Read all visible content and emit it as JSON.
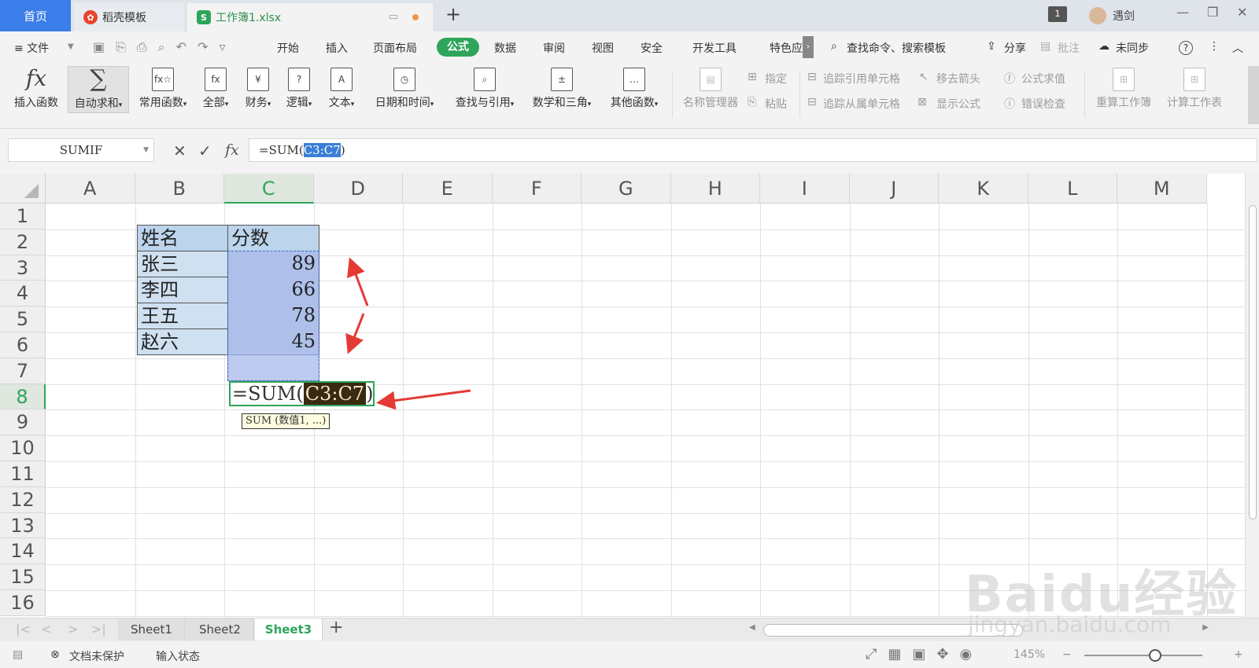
{
  "titlebar": {
    "home_tab": "首页",
    "tabs": [
      {
        "label": "稻壳模板",
        "logo": "daoke-logo"
      },
      {
        "label": "工作簿1.xlsx",
        "logo": "spreadsheet-logo"
      }
    ],
    "new_tab": "+",
    "user_badge": "1",
    "username": "遇剑",
    "window_controls": [
      "—",
      "❐",
      "✕"
    ]
  },
  "menu": {
    "file": "≡ 文件",
    "items": [
      "开始",
      "插入",
      "页面布局",
      "公式",
      "数据",
      "审阅",
      "视图",
      "安全",
      "开发工具",
      "特色应"
    ],
    "active": "公式",
    "search": "查找命令、搜索模板",
    "share": "分享",
    "annotate": "批注",
    "sync": "未同步",
    "help": "?"
  },
  "ribbon": {
    "insert_function": "插入函数",
    "autosum": "自动求和",
    "common": "常用函数",
    "all": "全部",
    "finance": "财务",
    "logic": "逻辑",
    "text": "文本",
    "datetime": "日期和时间",
    "lookup": "查找与引用",
    "math": "数学和三角",
    "other": "其他函数",
    "name_manager": "名称管理器",
    "specify": "指定",
    "paste": "粘贴",
    "trace_precedents": "追踪引用单元格",
    "trace_dependents": "追踪从属单元格",
    "remove_arrows": "移去箭头",
    "show_formulas": "显示公式",
    "evaluate": "公式求值",
    "error_check": "错误检查",
    "recalc_book": "重算工作簿",
    "calc_sheet": "计算工作表"
  },
  "formula_bar": {
    "name_box": "SUMIF",
    "cancel": "✕",
    "enter": "✓",
    "fx": "fx",
    "formula_prefix": "=SUM(",
    "formula_ref": "C3:C7",
    "formula_suffix": ")"
  },
  "grid": {
    "columns": [
      "A",
      "B",
      "C",
      "D",
      "E",
      "F",
      "G",
      "H",
      "I",
      "J",
      "K",
      "L",
      "M"
    ],
    "rows": [
      "1",
      "2",
      "3",
      "4",
      "5",
      "6",
      "7",
      "8",
      "9",
      "10",
      "11",
      "12",
      "13",
      "14",
      "15",
      "16"
    ],
    "selected_column": "C",
    "selected_row": "8",
    "header_name": "姓名",
    "header_score": "分数",
    "data": [
      {
        "name": "张三",
        "score": "89"
      },
      {
        "name": "李四",
        "score": "66"
      },
      {
        "name": "王五",
        "score": "78"
      },
      {
        "name": "赵六",
        "score": "45"
      }
    ],
    "edit_prefix": "=SUM(",
    "edit_ref": "C3:C7",
    "edit_suffix": ")",
    "tooltip": "SUM (数值1, ...)",
    "arrow_color": "#e53935"
  },
  "sheets": {
    "tabs": [
      "Sheet1",
      "Sheet2",
      "Sheet3"
    ],
    "active": "Sheet3",
    "add": "+"
  },
  "status": {
    "protect": "文档未保护",
    "mode": "输入状态",
    "zoom": "145%",
    "zoom_level": 0.6
  },
  "watermark": {
    "brand": "Baidu经验",
    "url": "jingyan.baidu.com"
  },
  "colors": {
    "accent_green": "#2ea55b",
    "home_blue": "#3b7de9",
    "selection_blue": "#aec0ea"
  }
}
